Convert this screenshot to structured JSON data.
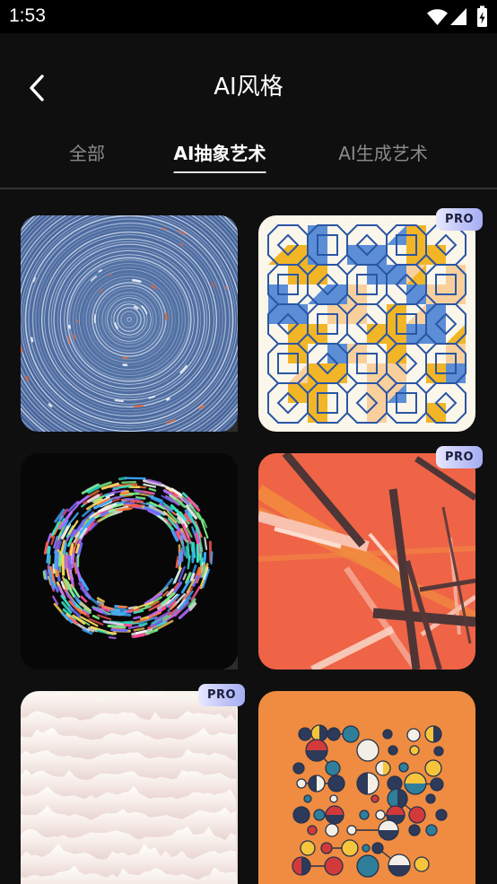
{
  "status_bar": {
    "time": "1:53",
    "icons": [
      "wifi-icon",
      "signal-icon",
      "battery-charging-icon"
    ]
  },
  "header": {
    "back_icon": "chevron-left-icon",
    "title": "AI风格"
  },
  "tabs": [
    {
      "label": "全部",
      "active": false
    },
    {
      "label": "AI抽象艺术",
      "active": true
    },
    {
      "label": "AI生成艺术",
      "active": false
    }
  ],
  "cards": [
    {
      "pro": false
    },
    {
      "pro": true,
      "badge": "PRO"
    },
    {
      "pro": false
    },
    {
      "pro": true,
      "badge": "PRO"
    },
    {
      "pro": true,
      "badge": "PRO"
    },
    {
      "pro": false
    }
  ],
  "colors": {
    "background": "#0f0f0f",
    "status_bar": "#000000",
    "active_tab": "#ffffff",
    "inactive_tab": "#8a8a8a",
    "divider": "#353535",
    "pro_badge_text": "#1c1e3e"
  }
}
